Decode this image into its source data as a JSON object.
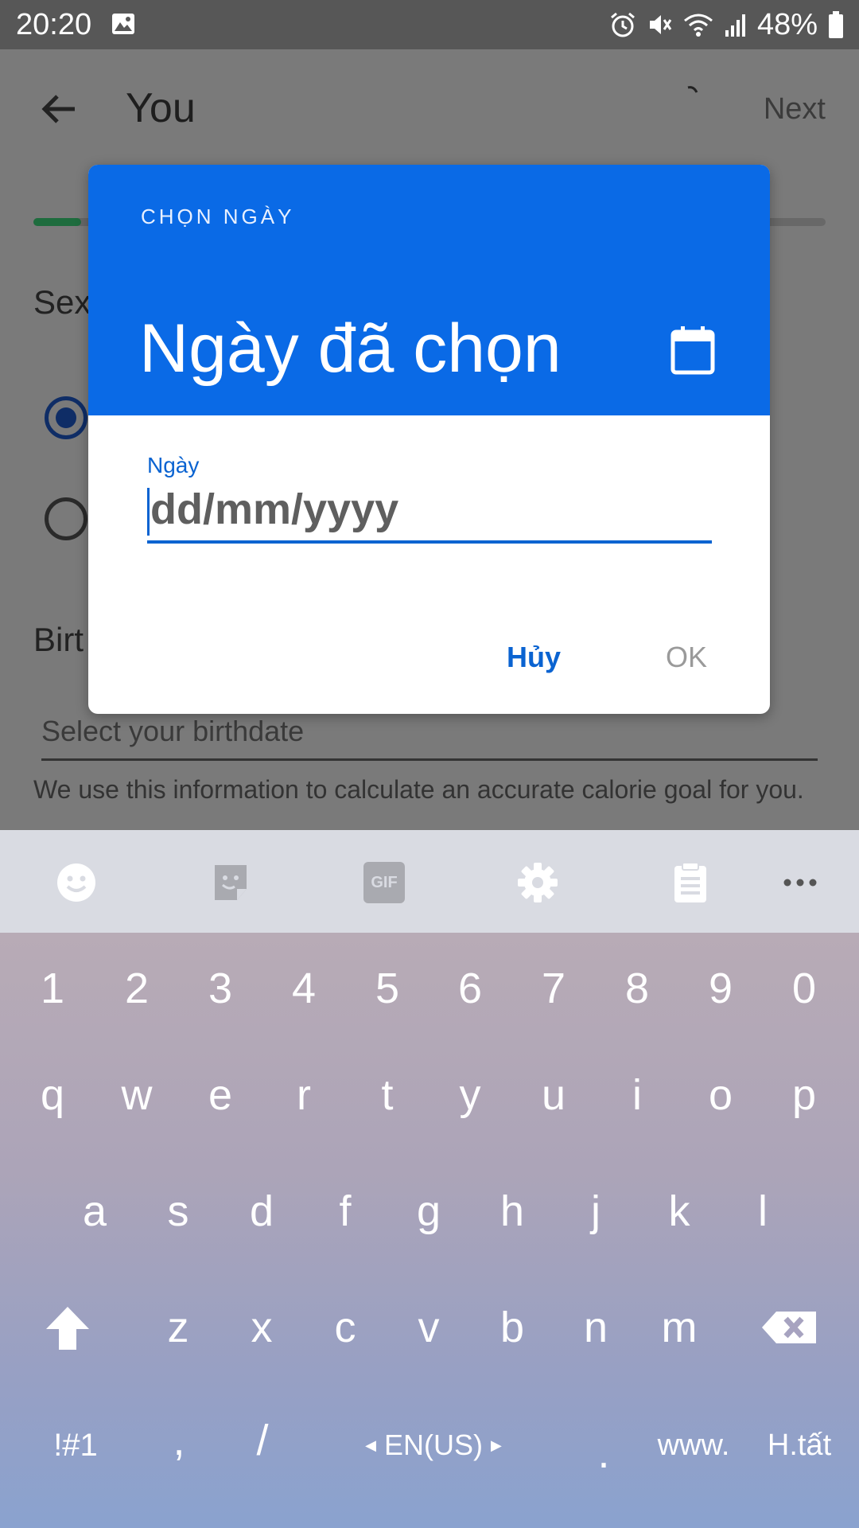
{
  "status_bar": {
    "time": "20:20",
    "battery": "48%"
  },
  "app_bar": {
    "title": "You",
    "next_label": "Next"
  },
  "background": {
    "sex_label": "Sex",
    "birth_label": "Birt",
    "birthdate_placeholder": "Select your birthdate",
    "info_text": "We use this information to calculate an accurate calorie goal for you.",
    "progress_fraction": 0.06
  },
  "dialog": {
    "header_small": "CHỌN NGÀY",
    "header_title": "Ngày đã chọn",
    "field_label": "Ngày",
    "input_placeholder": "dd/mm/yyyy",
    "cancel_label": "Hủy",
    "ok_label": "OK",
    "accent_color": "#0a6ae6"
  },
  "keyboard": {
    "toolbar": [
      "emoji-icon",
      "sticker-icon",
      "gif-icon",
      "settings-icon",
      "clipboard-icon",
      "more-icon"
    ],
    "gif_label": "GIF",
    "row_numbers": [
      "1",
      "2",
      "3",
      "4",
      "5",
      "6",
      "7",
      "8",
      "9",
      "0"
    ],
    "row_top": [
      "q",
      "w",
      "e",
      "r",
      "t",
      "y",
      "u",
      "i",
      "o",
      "p"
    ],
    "row_mid": [
      "a",
      "s",
      "d",
      "f",
      "g",
      "h",
      "j",
      "k",
      "l"
    ],
    "row_low": [
      "z",
      "x",
      "c",
      "v",
      "b",
      "n",
      "m"
    ],
    "symbols_label": "!#1",
    "comma_label": ",",
    "slash_label": "/",
    "language_label": "EN(US)",
    "period_label": ".",
    "www_label": "www.",
    "done_label": "H.tất"
  }
}
